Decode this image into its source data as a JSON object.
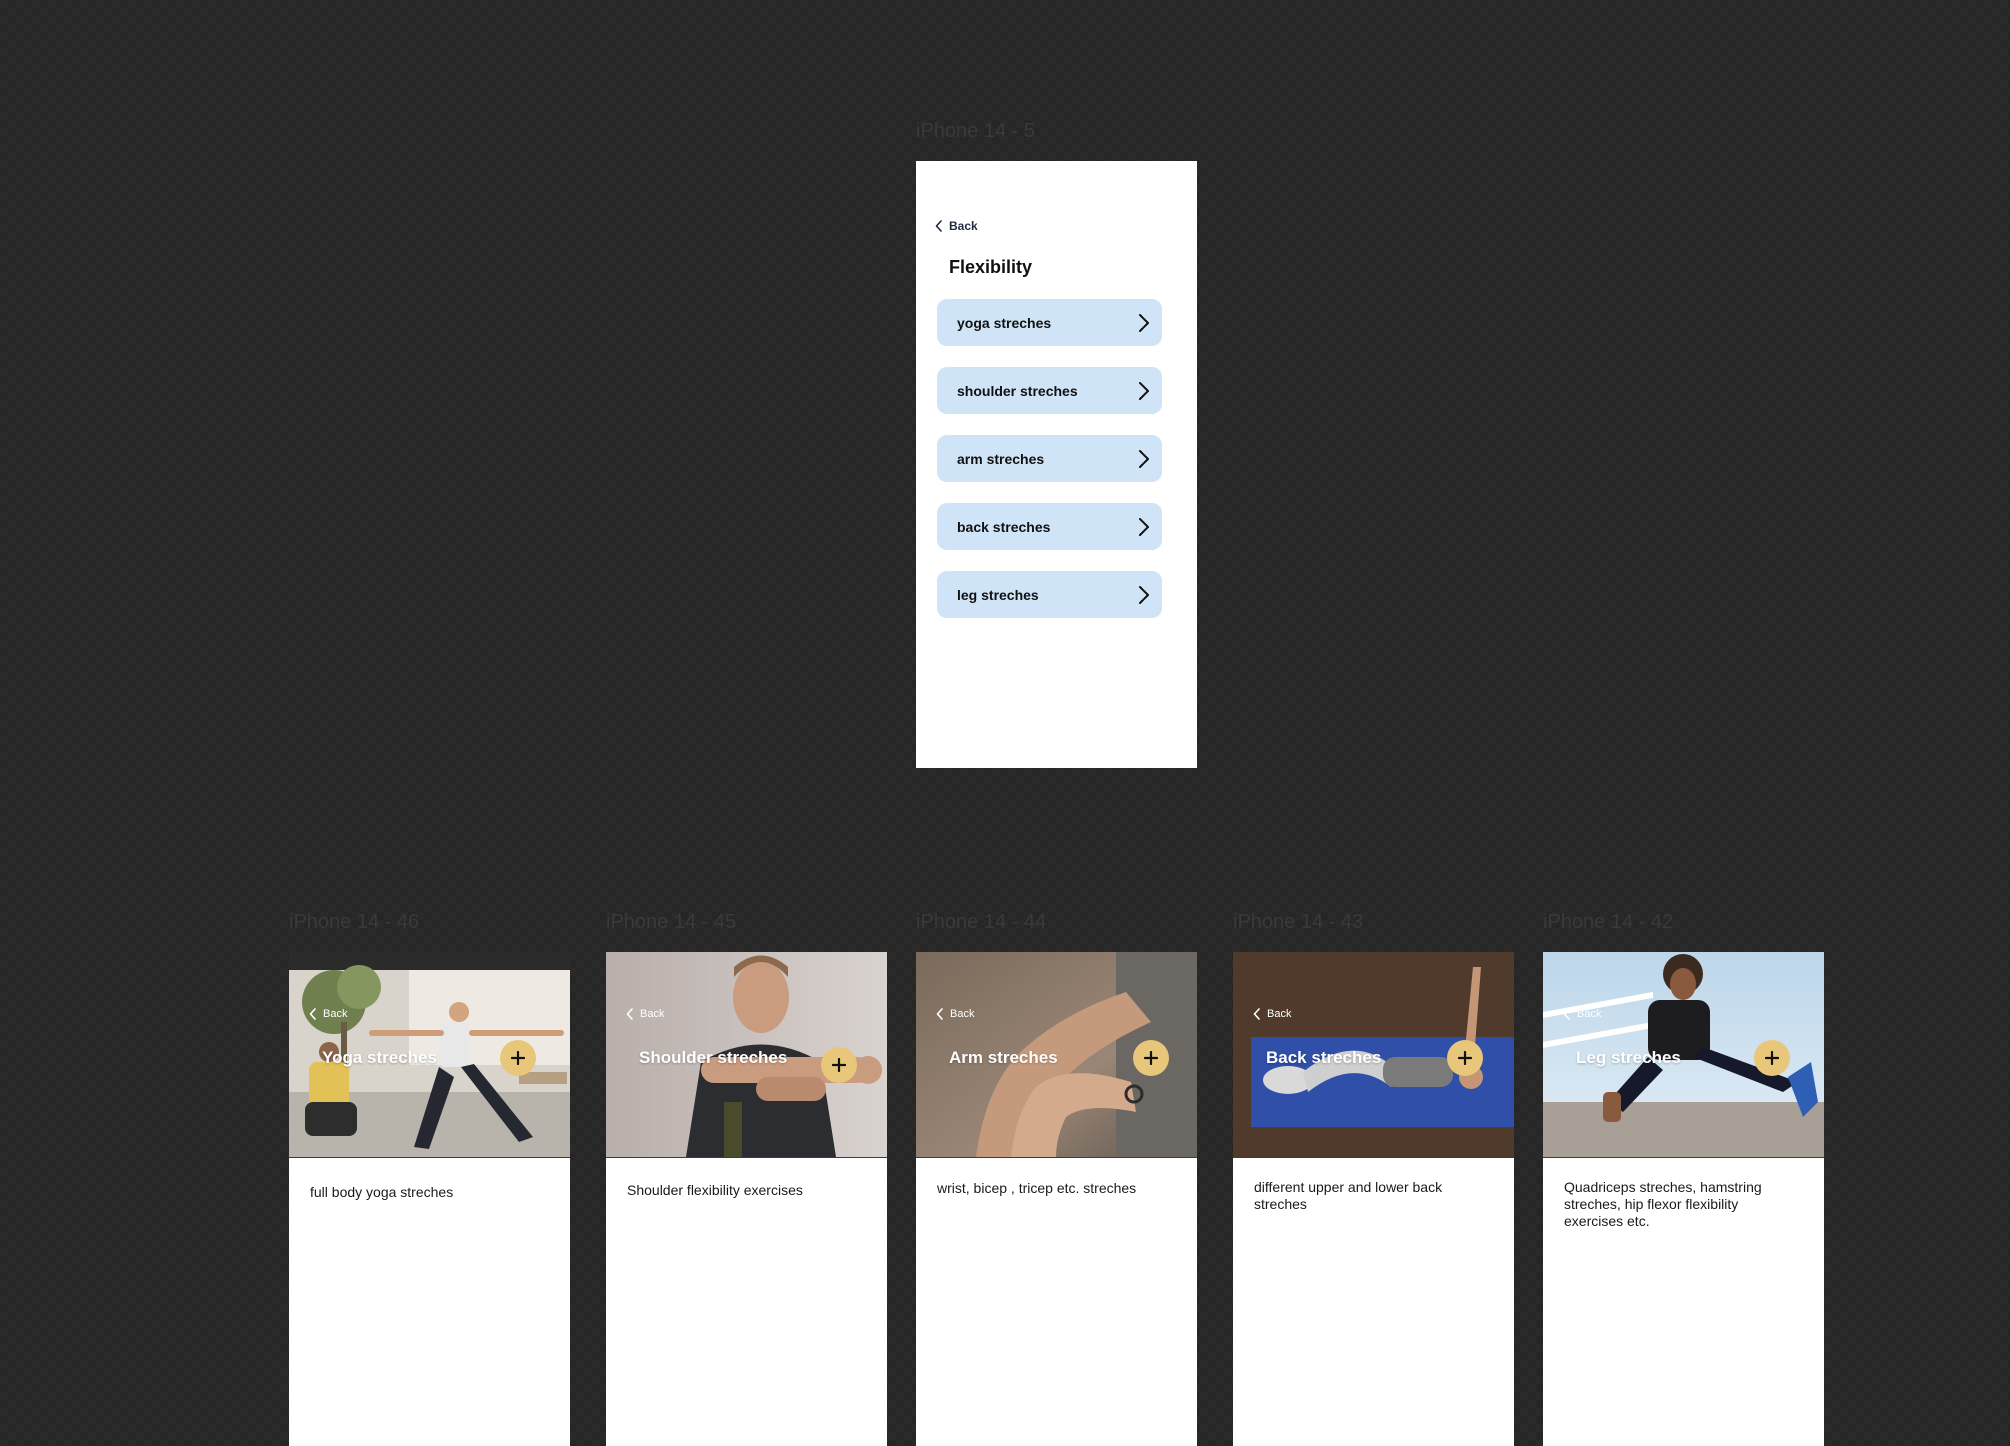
{
  "main": {
    "frame_label": "iPhone 14 - 5",
    "back_label": "Back",
    "title": "Flexibility",
    "items": [
      {
        "label": "yoga streches"
      },
      {
        "label": "shoulder streches"
      },
      {
        "label": "arm streches"
      },
      {
        "label": "back streches"
      },
      {
        "label": "leg streches"
      }
    ]
  },
  "details": [
    {
      "frame_label": "iPhone 14 - 46",
      "back_label": "Back",
      "title": "Yoga streches",
      "description": "full body yoga streches"
    },
    {
      "frame_label": "iPhone 14 - 45",
      "back_label": "Back",
      "title": "Shoulder streches",
      "description": "Shoulder flexibility exercises"
    },
    {
      "frame_label": "iPhone 14 - 44",
      "back_label": "Back",
      "title": "Arm streches",
      "description": "wrist, bicep , tricep etc. streches"
    },
    {
      "frame_label": "iPhone 14 - 43",
      "back_label": "Back",
      "title": "Back streches",
      "description": "different upper and lower back streches"
    },
    {
      "frame_label": "iPhone 14 - 42",
      "back_label": "Back",
      "title": "Leg streches",
      "description": "Quadriceps streches, hamstring streches, hip flexor flexibility exercises etc."
    }
  ],
  "colors": {
    "canvas": "#2a2a2a",
    "menu_item_bg": "#cfe4f7",
    "add_button": "#e8c77a",
    "frame_bg": "#ffffff"
  },
  "icons": {
    "back": "chevron-left-icon",
    "menu_chevron": "chevron-right-icon",
    "add": "plus-icon"
  }
}
